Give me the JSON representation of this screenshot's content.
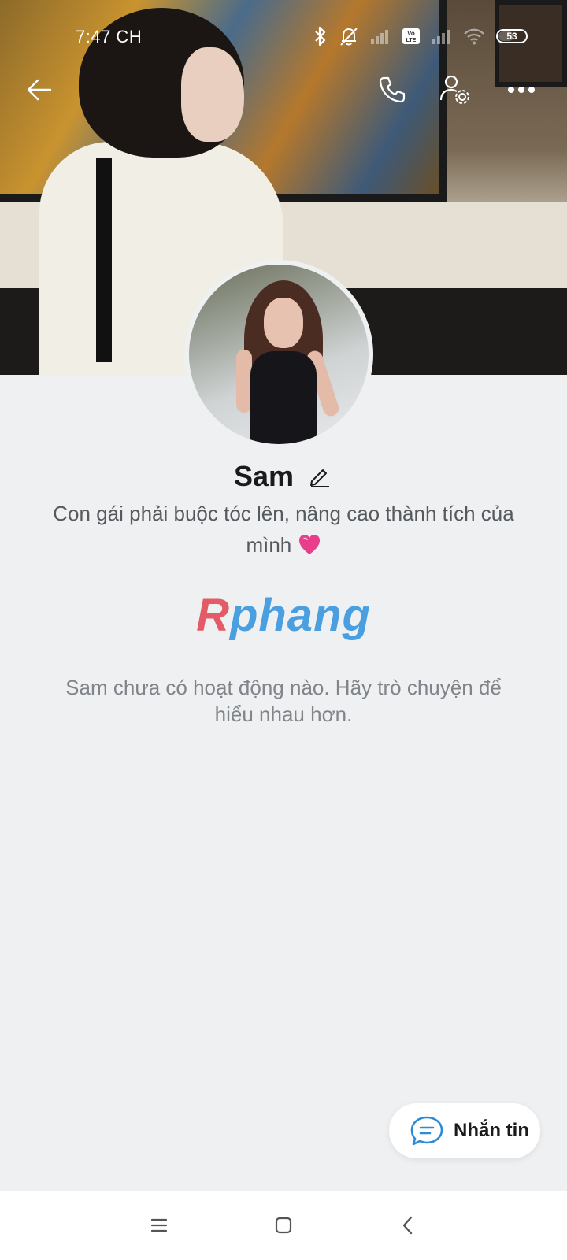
{
  "status_bar": {
    "time": "7:47 CH",
    "battery_level": "53",
    "icons": [
      "bluetooth-icon",
      "bell-off-icon",
      "signal-icon",
      "volte-icon",
      "signal-icon",
      "wifi-icon",
      "battery-icon"
    ]
  },
  "topbar": {
    "icons": [
      "arrow-left-icon",
      "phone-icon",
      "user-settings-icon",
      "more-icon"
    ]
  },
  "profile": {
    "name": "Sam",
    "bio": "Con gái phải buộc tóc lên, nâng cao thành tích của mình"
  },
  "watermark": {
    "first_letter": "R",
    "rest": "phang"
  },
  "empty_state": {
    "message": "Sam chưa có hoạt động nào. Hãy trò chuyện để hiểu nhau hơn."
  },
  "message_button": {
    "label": "Nhắn tin",
    "icon": "chat-bubble-icon"
  },
  "nav_bar": {
    "icons": [
      "menu-icon",
      "home-square-icon",
      "back-chevron-icon"
    ]
  },
  "colors": {
    "background": "#eef0f2",
    "watermark_red": "#e35b66",
    "watermark_blue": "#4a9fe0",
    "chat_icon": "#2a8cd6"
  }
}
